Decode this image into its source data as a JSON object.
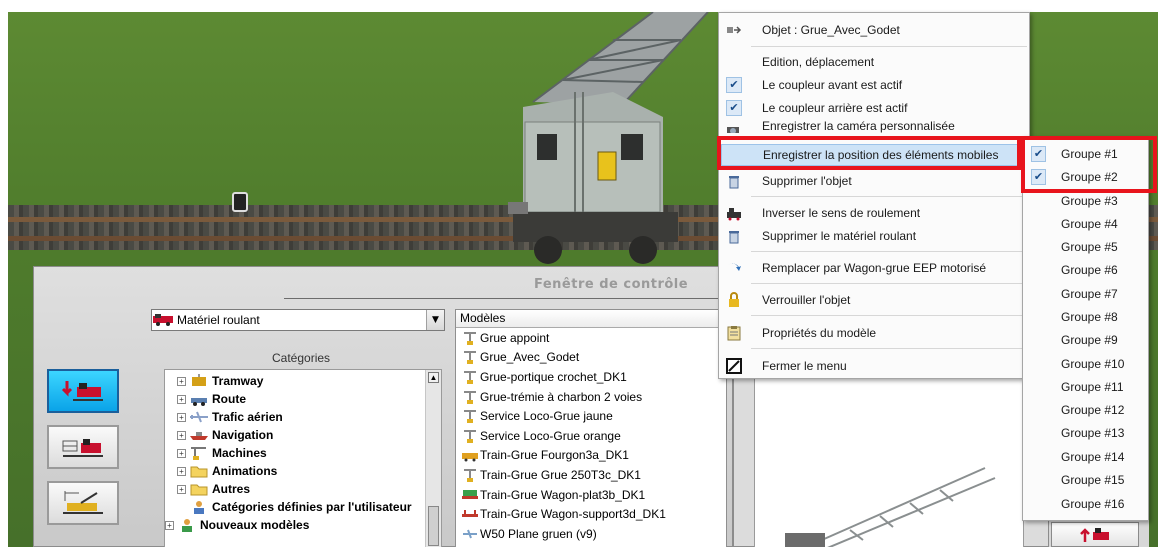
{
  "context_menu": {
    "header": "Objet : Grue_Avec_Godet",
    "items": [
      {
        "label": "Edition, déplacement",
        "icon": "none",
        "checked": false
      },
      {
        "label": "Le coupleur avant est actif",
        "icon": "checkmark-icon",
        "checked": true
      },
      {
        "label": "Le coupleur arrière est actif",
        "icon": "checkmark-icon",
        "checked": true
      },
      {
        "label": "Enregistrer la caméra personnalisée",
        "icon": "camera-icon",
        "checked": false
      },
      {
        "label": "Enregistrer la position des éléments mobiles",
        "icon": "none",
        "highlighted": true,
        "has_submenu": true
      },
      {
        "label": "Supprimer l'objet",
        "icon": "trash-icon"
      },
      {
        "label": "Inverser le sens de roulement",
        "icon": "locomotive-icon"
      },
      {
        "label": "Supprimer le matériel roulant",
        "icon": "trash-icon"
      },
      {
        "label": "Remplacer par Wagon-grue EEP motorisé",
        "icon": "swap-arrow-icon"
      },
      {
        "label": "Verrouiller l'objet",
        "icon": "lock-icon"
      },
      {
        "label": "Propriétés du modèle",
        "icon": "clipboard-icon"
      },
      {
        "label": "Fermer le menu",
        "icon": "close-box-icon"
      }
    ]
  },
  "submenu": {
    "items": [
      {
        "label": "Groupe #1",
        "checked": true
      },
      {
        "label": "Groupe #2",
        "checked": true
      },
      {
        "label": "Groupe #3",
        "checked": false
      },
      {
        "label": "Groupe #4",
        "checked": false
      },
      {
        "label": "Groupe #5",
        "checked": false
      },
      {
        "label": "Groupe #6",
        "checked": false
      },
      {
        "label": "Groupe #7",
        "checked": false
      },
      {
        "label": "Groupe #8",
        "checked": false
      },
      {
        "label": "Groupe #9",
        "checked": false
      },
      {
        "label": "Groupe #10",
        "checked": false
      },
      {
        "label": "Groupe #11",
        "checked": false
      },
      {
        "label": "Groupe #12",
        "checked": false
      },
      {
        "label": "Groupe #13",
        "checked": false
      },
      {
        "label": "Groupe #14",
        "checked": false
      },
      {
        "label": "Groupe #15",
        "checked": false
      },
      {
        "label": "Groupe #16",
        "checked": false
      }
    ]
  },
  "control_panel": {
    "title": "Fenêtre de contrôle",
    "category_select": {
      "value": "Matériel roulant"
    },
    "categories_label": "Catégories",
    "tree": [
      {
        "label": "Tramway",
        "level": 1,
        "icon": "tram-icon"
      },
      {
        "label": "Route",
        "level": 1,
        "icon": "car-icon"
      },
      {
        "label": "Trafic aérien",
        "level": 1,
        "icon": "plane-icon"
      },
      {
        "label": "Navigation",
        "level": 1,
        "icon": "ship-icon"
      },
      {
        "label": "Machines",
        "level": 1,
        "icon": "crane-icon"
      },
      {
        "label": "Animations",
        "level": 1,
        "icon": "folder-icon"
      },
      {
        "label": "Autres",
        "level": 1,
        "icon": "folder-icon"
      },
      {
        "label": "Catégories définies par l'utilisateur",
        "level": 1,
        "icon": "user-icon"
      },
      {
        "label": "Nouveaux modèles",
        "level": 0,
        "icon": "person-icon"
      }
    ],
    "models_header": "Modèles",
    "models": [
      "Grue appoint",
      "Grue_Avec_Godet",
      "Grue-portique crochet_DK1",
      "Grue-trémie à charbon 2 voies",
      "Service Loco-Grue jaune",
      "Service Loco-Grue orange",
      "Train-Grue Fourgon3a_DK1",
      "Train-Grue Grue 250T3c_DK1",
      "Train-Grue Wagon-plat3b_DK1",
      "Train-Grue Wagon-support3d_DK1",
      "W50 Plane gruen (v9)"
    ]
  },
  "colors": {
    "highlight_box": "#e8141c",
    "menu_highlight": "#cde3f7",
    "active_button": "#0aa3e8"
  }
}
